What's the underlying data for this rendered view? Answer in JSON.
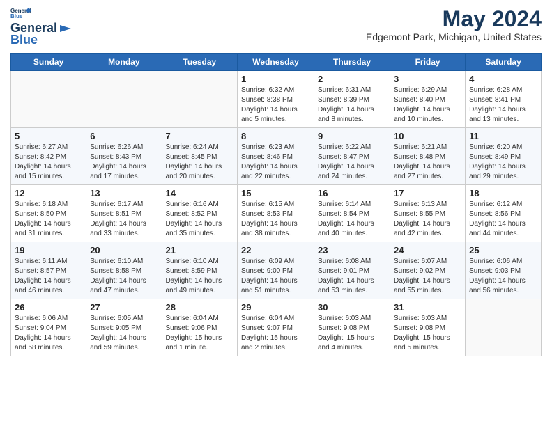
{
  "logo": {
    "line1": "General",
    "line2": "Blue"
  },
  "title": "May 2024",
  "location": "Edgemont Park, Michigan, United States",
  "weekdays": [
    "Sunday",
    "Monday",
    "Tuesday",
    "Wednesday",
    "Thursday",
    "Friday",
    "Saturday"
  ],
  "weeks": [
    [
      {
        "day": "",
        "empty": true
      },
      {
        "day": "",
        "empty": true
      },
      {
        "day": "",
        "empty": true
      },
      {
        "day": "1",
        "sunrise": "6:32 AM",
        "sunset": "8:38 PM",
        "daylight": "14 hours and 5 minutes."
      },
      {
        "day": "2",
        "sunrise": "6:31 AM",
        "sunset": "8:39 PM",
        "daylight": "14 hours and 8 minutes."
      },
      {
        "day": "3",
        "sunrise": "6:29 AM",
        "sunset": "8:40 PM",
        "daylight": "14 hours and 10 minutes."
      },
      {
        "day": "4",
        "sunrise": "6:28 AM",
        "sunset": "8:41 PM",
        "daylight": "14 hours and 13 minutes."
      }
    ],
    [
      {
        "day": "5",
        "sunrise": "6:27 AM",
        "sunset": "8:42 PM",
        "daylight": "14 hours and 15 minutes."
      },
      {
        "day": "6",
        "sunrise": "6:26 AM",
        "sunset": "8:43 PM",
        "daylight": "14 hours and 17 minutes."
      },
      {
        "day": "7",
        "sunrise": "6:24 AM",
        "sunset": "8:45 PM",
        "daylight": "14 hours and 20 minutes."
      },
      {
        "day": "8",
        "sunrise": "6:23 AM",
        "sunset": "8:46 PM",
        "daylight": "14 hours and 22 minutes."
      },
      {
        "day": "9",
        "sunrise": "6:22 AM",
        "sunset": "8:47 PM",
        "daylight": "14 hours and 24 minutes."
      },
      {
        "day": "10",
        "sunrise": "6:21 AM",
        "sunset": "8:48 PM",
        "daylight": "14 hours and 27 minutes."
      },
      {
        "day": "11",
        "sunrise": "6:20 AM",
        "sunset": "8:49 PM",
        "daylight": "14 hours and 29 minutes."
      }
    ],
    [
      {
        "day": "12",
        "sunrise": "6:18 AM",
        "sunset": "8:50 PM",
        "daylight": "14 hours and 31 minutes."
      },
      {
        "day": "13",
        "sunrise": "6:17 AM",
        "sunset": "8:51 PM",
        "daylight": "14 hours and 33 minutes."
      },
      {
        "day": "14",
        "sunrise": "6:16 AM",
        "sunset": "8:52 PM",
        "daylight": "14 hours and 35 minutes."
      },
      {
        "day": "15",
        "sunrise": "6:15 AM",
        "sunset": "8:53 PM",
        "daylight": "14 hours and 38 minutes."
      },
      {
        "day": "16",
        "sunrise": "6:14 AM",
        "sunset": "8:54 PM",
        "daylight": "14 hours and 40 minutes."
      },
      {
        "day": "17",
        "sunrise": "6:13 AM",
        "sunset": "8:55 PM",
        "daylight": "14 hours and 42 minutes."
      },
      {
        "day": "18",
        "sunrise": "6:12 AM",
        "sunset": "8:56 PM",
        "daylight": "14 hours and 44 minutes."
      }
    ],
    [
      {
        "day": "19",
        "sunrise": "6:11 AM",
        "sunset": "8:57 PM",
        "daylight": "14 hours and 46 minutes."
      },
      {
        "day": "20",
        "sunrise": "6:10 AM",
        "sunset": "8:58 PM",
        "daylight": "14 hours and 47 minutes."
      },
      {
        "day": "21",
        "sunrise": "6:10 AM",
        "sunset": "8:59 PM",
        "daylight": "14 hours and 49 minutes."
      },
      {
        "day": "22",
        "sunrise": "6:09 AM",
        "sunset": "9:00 PM",
        "daylight": "14 hours and 51 minutes."
      },
      {
        "day": "23",
        "sunrise": "6:08 AM",
        "sunset": "9:01 PM",
        "daylight": "14 hours and 53 minutes."
      },
      {
        "day": "24",
        "sunrise": "6:07 AM",
        "sunset": "9:02 PM",
        "daylight": "14 hours and 55 minutes."
      },
      {
        "day": "25",
        "sunrise": "6:06 AM",
        "sunset": "9:03 PM",
        "daylight": "14 hours and 56 minutes."
      }
    ],
    [
      {
        "day": "26",
        "sunrise": "6:06 AM",
        "sunset": "9:04 PM",
        "daylight": "14 hours and 58 minutes."
      },
      {
        "day": "27",
        "sunrise": "6:05 AM",
        "sunset": "9:05 PM",
        "daylight": "14 hours and 59 minutes."
      },
      {
        "day": "28",
        "sunrise": "6:04 AM",
        "sunset": "9:06 PM",
        "daylight": "15 hours and 1 minute."
      },
      {
        "day": "29",
        "sunrise": "6:04 AM",
        "sunset": "9:07 PM",
        "daylight": "15 hours and 2 minutes."
      },
      {
        "day": "30",
        "sunrise": "6:03 AM",
        "sunset": "9:08 PM",
        "daylight": "15 hours and 4 minutes."
      },
      {
        "day": "31",
        "sunrise": "6:03 AM",
        "sunset": "9:08 PM",
        "daylight": "15 hours and 5 minutes."
      },
      {
        "day": "",
        "empty": true
      }
    ]
  ]
}
